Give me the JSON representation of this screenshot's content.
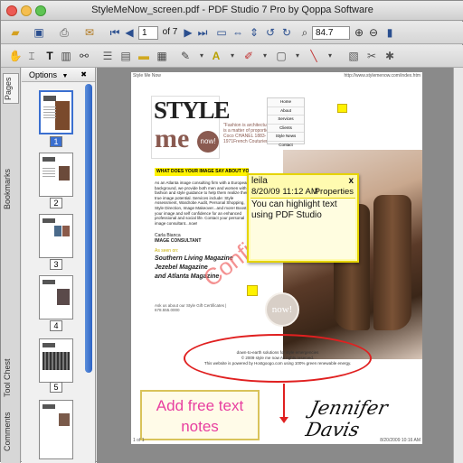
{
  "window": {
    "title": "StyleMeNow_screen.pdf - PDF Studio 7 Pro by Qoppa Software"
  },
  "toolbar": {
    "page_current": "1",
    "page_total_label": "of 7",
    "zoom": "84.7"
  },
  "sidebar": {
    "tabs": [
      "Pages",
      "Bookmarks",
      "Tool Chest",
      "Comments"
    ],
    "options_label": "Options",
    "close_label": "✖",
    "page_numbers": [
      "1",
      "2",
      "3",
      "4",
      "5"
    ]
  },
  "document": {
    "header_left": "Style Me Now",
    "header_right": "http://www.stylemenow.com/index.htm",
    "logo_style": "STYLE",
    "logo_me": "me",
    "logo_now": "now!",
    "quote": "\"Fashion is architecture: it is a matter of proportions.\" Coco CHANEL 1883-1971French Couturier",
    "nav": [
      "Home",
      "About",
      "Services",
      "Clients",
      "Style News",
      "Contact"
    ],
    "heading": "WHAT DOES YOUR IMAGE SAY ABOUT YOU?",
    "body": "As an Atlanta image consulting firm with a European background, we provide both men and women with fashion and style guidance to help them realize their true image potential. Services include: Style Assessment, Wardrobe Audit, Personal Shopping, Style Direction, Image Makeover...and more! Boost your image and self confidence for an enhanced professional and social life. Contact your personal image consultant...now!",
    "signature_name": "Carla Bianca",
    "signature_title": "IMAGE CONSULTANT",
    "press_intro": "As seen on:",
    "press": [
      "Southern Living Magazine",
      "Jezebel Magazine",
      "and Atlanta Magazine"
    ],
    "gift": "Ask us about our Style Gift Certificates | 678.555.0000",
    "watermark": "Confidential",
    "footer_lines": [
      "down-to-earth solutions for style emergencies",
      "© 2009 style me now All rights reserved.",
      "This website is powered by Hostgoogo.com using 100% green renewable energy."
    ],
    "page_footer_left": "1 of 1",
    "page_footer_right": "8/20/2009 10:16 AM",
    "signature_text": "Jennifer Davis",
    "free_text": [
      "Add free text",
      "notes"
    ]
  },
  "note": {
    "author": "leila",
    "date": "8/20/09 11:12 AM",
    "properties": "Properties",
    "close": "x",
    "text": "You can highlight text using PDF Studio"
  },
  "colors": {
    "note_bg": "#fffbb0",
    "note_border": "#e6d400",
    "highlight": "#fff200",
    "ellipse": "#e02020",
    "free_text": "#e83fa0",
    "free_text_border": "#d9c35a",
    "watermark": "#f08080",
    "scroll": "#3a73d0"
  }
}
